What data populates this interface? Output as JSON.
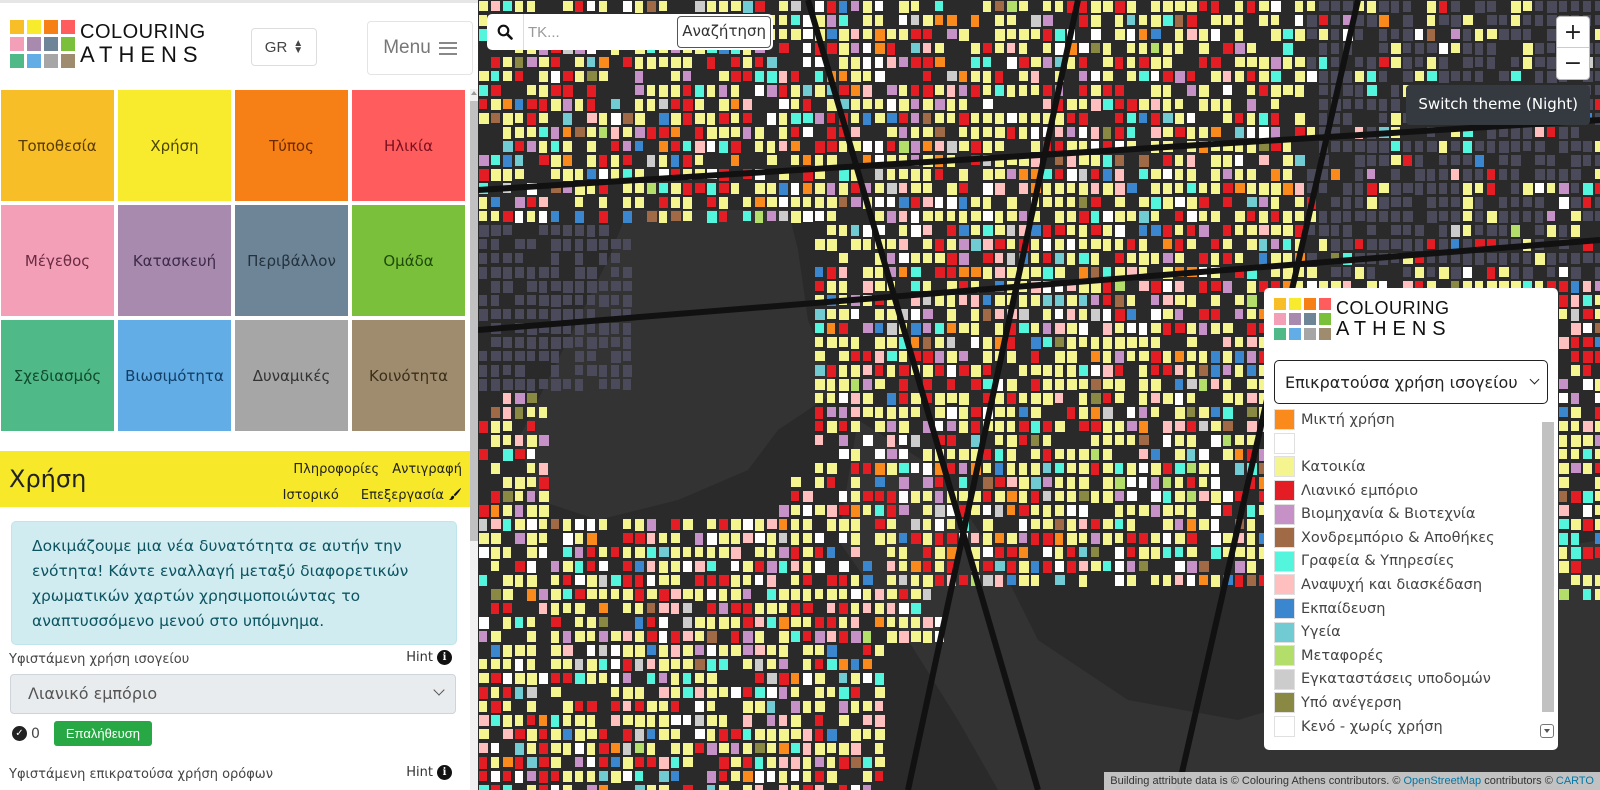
{
  "brand": {
    "line1": "COLOURING",
    "line2": "ATHENS",
    "logo_colors": [
      "#f8be28",
      "#f8ea2d",
      "#f67f16",
      "#ff5d5d",
      "#f29fb7",
      "#a88aaf",
      "#6e8597",
      "#7ac03a",
      "#50b988",
      "#62ade5",
      "#a6a6a6",
      "#9f8c6e"
    ]
  },
  "header": {
    "language": "GR",
    "menu_label": "Menu"
  },
  "categories": [
    {
      "label": "Τοποθεσία",
      "color": "#f8be28",
      "text": "#5a3b00"
    },
    {
      "label": "Χρήση",
      "color": "#f8ea2d",
      "text": "#4a4500"
    },
    {
      "label": "Τύπος",
      "color": "#f67f16",
      "text": "#6b2a00"
    },
    {
      "label": "Ηλικία",
      "color": "#ff5d5d",
      "text": "#7a1020"
    },
    {
      "label": "Μέγεθος",
      "color": "#f29fb7",
      "text": "#6b2a40"
    },
    {
      "label": "Κατασκευή",
      "color": "#a88aaf",
      "text": "#3e2a48"
    },
    {
      "label": "Περιβάλλον",
      "color": "#6e8597",
      "text": "#22323e"
    },
    {
      "label": "Ομάδα",
      "color": "#7ac03a",
      "text": "#1e4a0a"
    },
    {
      "label": "Σχεδιασμός",
      "color": "#50b988",
      "text": "#0f4a2e"
    },
    {
      "label": "Βιωσιμότητα",
      "color": "#62ade5",
      "text": "#123e66"
    },
    {
      "label": "Δυναμικές",
      "color": "#a6a6a6",
      "text": "#333333"
    },
    {
      "label": "Κοινότητα",
      "color": "#9f8c6e",
      "text": "#3a2e1a"
    }
  ],
  "section": {
    "title": "Χρήση",
    "links": [
      "Πληροφορίες",
      "Αντιγραφή",
      "Ιστορικό",
      "Επεξεργασία"
    ],
    "alert": "Δοκιμάζουμε μια νέα δυνατότητα σε αυτήν την ενότητα! Κάντε εναλλαγή μεταξύ διαφορετικών χρωματικών χαρτών χρησιμοποιώντας το αναπτυσσόμενο μενού στο υπόμνημα.",
    "fields": [
      {
        "label": "Υφιστάμενη χρήση ισογείου",
        "hint": "Hint",
        "value": "Λιανικό εμπόριο",
        "verify_count": "0",
        "verify_label": "Επαλήθευση"
      },
      {
        "label": "Υφιστάμενη επικρατούσα χρήση ορόφων",
        "hint": "Hint"
      }
    ]
  },
  "map": {
    "search_placeholder": "ΤΚ...",
    "search_button": "Αναζήτηση",
    "zoom_in": "+",
    "zoom_out": "−",
    "theme_button": "Switch theme (Night)",
    "attribution": {
      "prefix": "Building attribute data is © Colouring Athens contributors. © ",
      "osm": "OpenStreetMap",
      "middle": " contributors © ",
      "carto": "CARTO"
    }
  },
  "legend": {
    "selected": "Επικρατούσα χρήση ισογείου",
    "items": [
      {
        "label": "Μικτή χρήση",
        "color": "#fa8a1b"
      },
      {
        "label": "",
        "color": "#ffffff"
      },
      {
        "label": "Κατοικία",
        "color": "#f5f58f"
      },
      {
        "label": "Λιανικό εμπόριο",
        "color": "#e31d23"
      },
      {
        "label": "Βιομηχανία & Βιοτεχνία",
        "color": "#c691c6"
      },
      {
        "label": "Χονδρεμπόριο & Αποθήκες",
        "color": "#a16a47"
      },
      {
        "label": "Γραφεία & Υπηρεσίες",
        "color": "#53f5dd"
      },
      {
        "label": "Αναψυχή και διασκέδαση",
        "color": "#ffbfbf"
      },
      {
        "label": "Εκπαίδευση",
        "color": "#3a87d0"
      },
      {
        "label": "Υγεία",
        "color": "#70cbd3"
      },
      {
        "label": "Μεταφορές",
        "color": "#b3de69"
      },
      {
        "label": "Εγκαταστάσεις υποδομών",
        "color": "#cccccc"
      },
      {
        "label": "Υπό ανέγερση",
        "color": "#898944"
      },
      {
        "label": "Κενό - χωρίς χρήση",
        "color": "#ffffff"
      }
    ]
  }
}
